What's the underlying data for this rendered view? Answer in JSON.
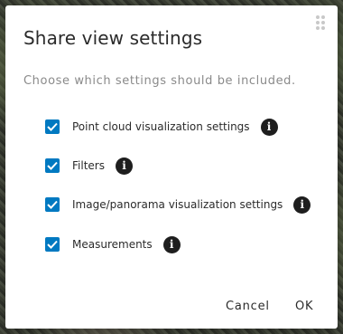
{
  "dialog": {
    "title": "Share view settings",
    "subtitle": "Choose which settings should be included.",
    "options": [
      {
        "label": "Point cloud visualization settings",
        "checked": true,
        "icon": "info-icon"
      },
      {
        "label": "Filters",
        "checked": true,
        "icon": "info-icon"
      },
      {
        "label": "Image/panorama visualization settings",
        "checked": true,
        "icon": "info-icon"
      },
      {
        "label": "Measurements",
        "checked": true,
        "icon": "info-icon"
      }
    ],
    "cancel_label": "Cancel",
    "ok_label": "OK",
    "info_glyph": "i",
    "colors": {
      "checkbox": "#0079c1",
      "info_icon": "#1e1e1e"
    }
  }
}
